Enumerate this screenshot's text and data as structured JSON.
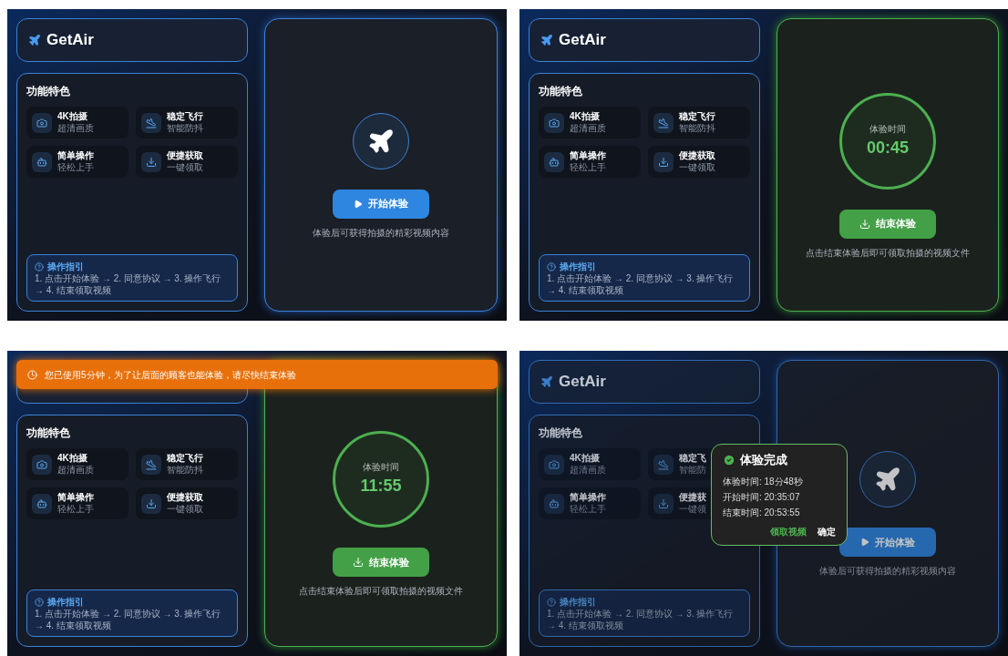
{
  "screens": [
    {
      "dimmed": false,
      "header": {
        "title": "GetAir"
      },
      "features_title": "功能特色",
      "features": [
        {
          "kind": "camera",
          "title": "4K拍摄",
          "subtitle": "超清画质"
        },
        {
          "kind": "plane",
          "title": "稳定飞行",
          "subtitle": "智能防抖"
        },
        {
          "kind": "bot",
          "title": "简单操作",
          "subtitle": "轻松上手"
        },
        {
          "kind": "download",
          "title": "便捷获取",
          "subtitle": "一键领取"
        }
      ],
      "guide": {
        "title": "操作指引",
        "steps": "1. 点击开始体验 → 2. 同意协议 → 3. 操作飞行 → 4. 结束领取视频"
      },
      "stage": {
        "kind": "idle",
        "button": "开始体验",
        "caption": "体验后可获得拍摄的精彩视频内容"
      }
    },
    {
      "dimmed": false,
      "header": {
        "title": "GetAir"
      },
      "features_title": "功能特色",
      "features": [
        {
          "kind": "camera",
          "title": "4K拍摄",
          "subtitle": "超清画质"
        },
        {
          "kind": "plane",
          "title": "稳定飞行",
          "subtitle": "智能防抖"
        },
        {
          "kind": "bot",
          "title": "简单操作",
          "subtitle": "轻松上手"
        },
        {
          "kind": "download",
          "title": "便捷获取",
          "subtitle": "一键领取"
        }
      ],
      "guide": {
        "title": "操作指引",
        "steps": "1. 点击开始体验 → 2. 同意协议 → 3. 操作飞行 → 4. 结束领取视频"
      },
      "stage": {
        "kind": "timer",
        "label": "体验时间",
        "time": "00:45",
        "button": "结束体验",
        "caption": "点击结束体验后即可领取拍摄的视频文件"
      }
    },
    {
      "dimmed": false,
      "banner": {
        "text": "您已使用5分钟，为了让后面的顾客也能体验，请尽快结束体验"
      },
      "features_title": "功能特色",
      "features": [
        {
          "kind": "camera",
          "title": "4K拍摄",
          "subtitle": "超清画质"
        },
        {
          "kind": "plane",
          "title": "稳定飞行",
          "subtitle": "智能防抖"
        },
        {
          "kind": "bot",
          "title": "简单操作",
          "subtitle": "轻松上手"
        },
        {
          "kind": "download",
          "title": "便捷获取",
          "subtitle": "一键领取"
        }
      ],
      "guide": {
        "title": "操作指引",
        "steps": "1. 点击开始体验 → 2. 同意协议 → 3. 操作飞行 → 4. 结束领取视频"
      },
      "stage": {
        "kind": "timer",
        "label": "体验时间",
        "time": "11:55",
        "button": "结束体验",
        "caption": "点击结束体验后即可领取拍摄的视频文件"
      }
    },
    {
      "dimmed": true,
      "header": {
        "title": "GetAir"
      },
      "features_title": "功能特色",
      "features": [
        {
          "kind": "camera",
          "title": "4K拍摄",
          "subtitle": "超清画质"
        },
        {
          "kind": "plane",
          "title": "稳定飞",
          "subtitle": "智能防"
        },
        {
          "kind": "bot",
          "title": "简单操作",
          "subtitle": "轻松上手"
        },
        {
          "kind": "download",
          "title": "便捷获",
          "subtitle": "一键领"
        }
      ],
      "guide": {
        "title": "操作指引",
        "steps": "1. 点击开始体验 → 2. 同意协议 → 3. 操作飞行 → 4. 结束领取视频"
      },
      "stage": {
        "kind": "idle",
        "button": "开始体验",
        "caption": "体验后可获得拍摄的精彩视频内容"
      },
      "dialog": {
        "title": "体验完成",
        "lines": [
          "体验时间: 18分48秒",
          "开始时间: 20:35:07",
          "结束时间: 20:53:55"
        ],
        "buttons": [
          {
            "kind": "primary",
            "label": "领取视频"
          },
          {
            "kind": "plain",
            "label": "确定"
          }
        ]
      }
    }
  ]
}
